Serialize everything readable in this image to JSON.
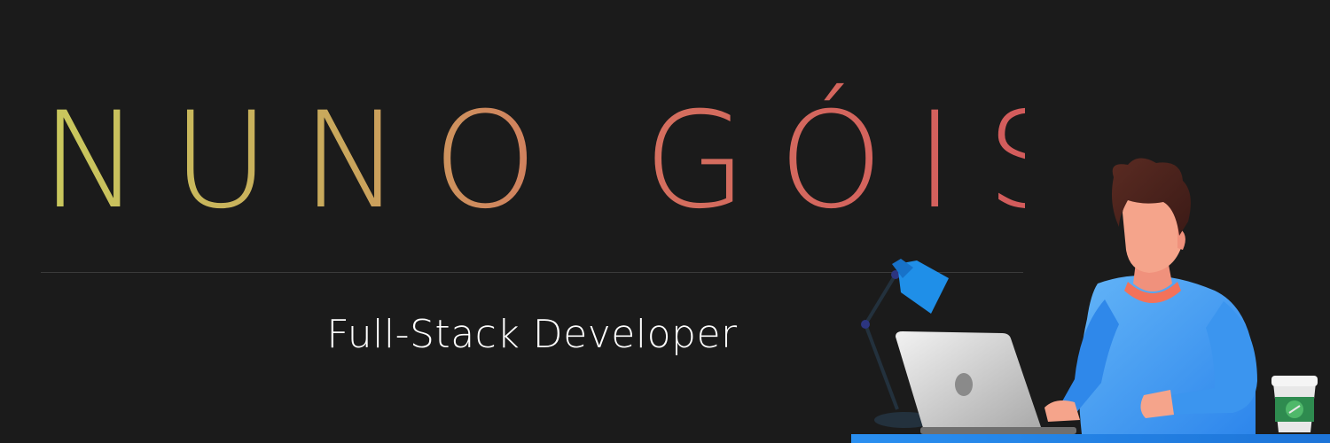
{
  "banner": {
    "name": "NUNO GÓIS",
    "subtitle": "Full-Stack Developer"
  },
  "colors": {
    "background": "#1b1b1b",
    "name_gradient_start": "#c9c95d",
    "name_gradient_end": "#d35c5c",
    "shirt": "#3a9bf2",
    "desk": "#2e8ff0",
    "lamp": "#1f8fe8"
  },
  "illustration": {
    "items": [
      "developer-figure",
      "laptop",
      "desk-lamp",
      "coffee-cup",
      "desk"
    ]
  }
}
